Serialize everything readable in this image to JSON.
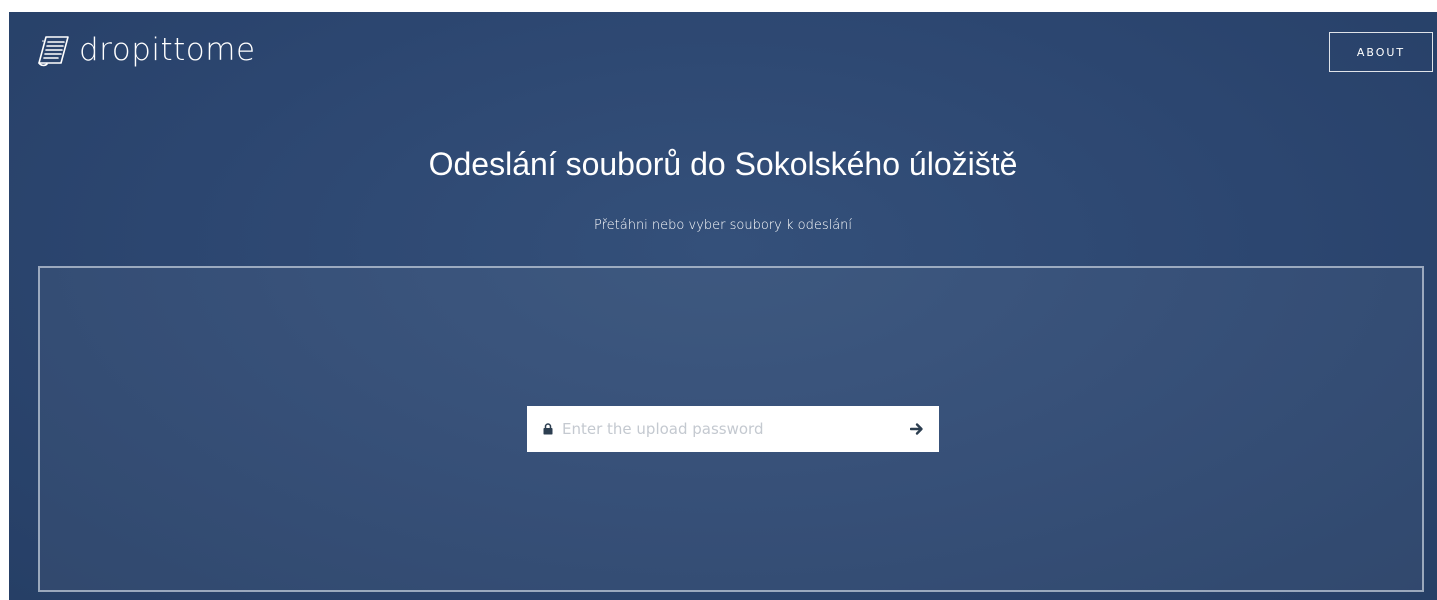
{
  "header": {
    "logo_text": "dropittome",
    "logo_icon": "paper-stack-icon",
    "about_label": "ABOUT"
  },
  "main": {
    "title": "Odeslání souborů do Sokolského úložiště",
    "subtitle": "Přetáhni nebo vyber soubory k odeslání"
  },
  "password_form": {
    "placeholder": "Enter the upload password",
    "value": "",
    "lock_icon": "lock-icon",
    "submit_icon": "arrow-right-icon"
  },
  "colors": {
    "background": "#2c4670",
    "dropzone_border": "#bec8d7",
    "input_background": "#ffffff",
    "text": "#ffffff"
  }
}
